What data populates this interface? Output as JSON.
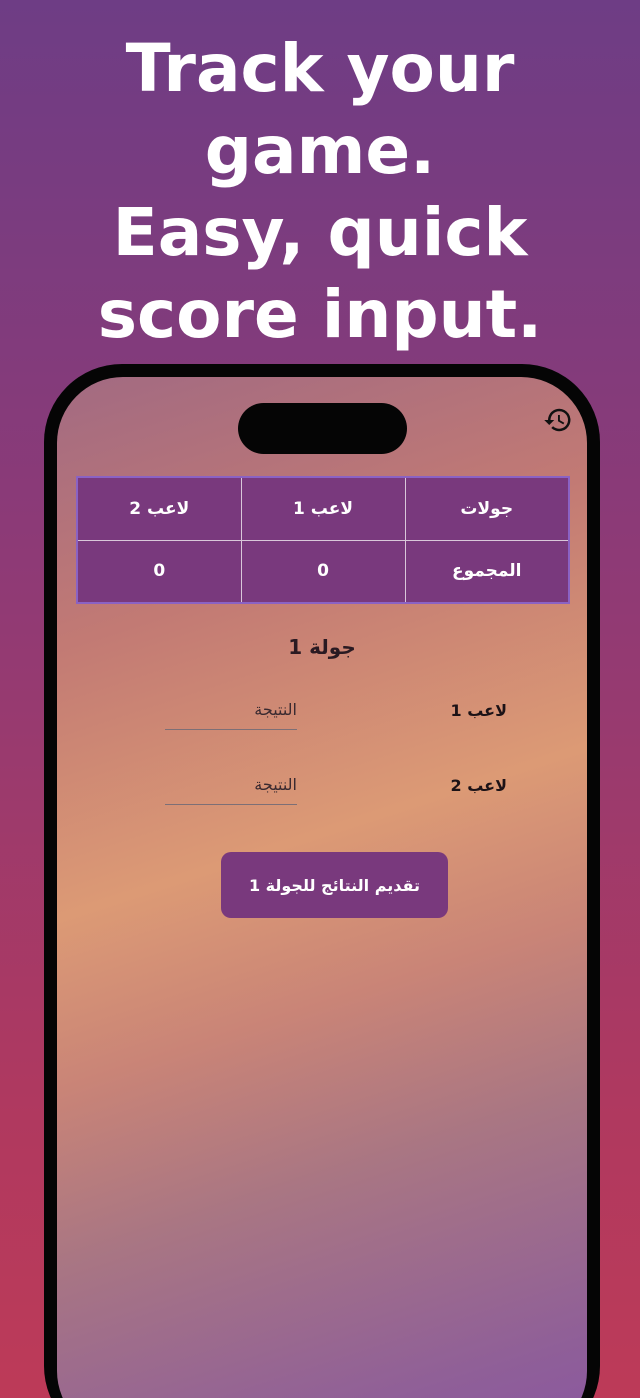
{
  "headline": {
    "line1": "Track your",
    "line2": "game.",
    "line3": "Easy, quick",
    "line4": "score input."
  },
  "history_icon": "history-icon",
  "table": {
    "header": [
      "جولات",
      "لاعب 1",
      "لاعب 2"
    ],
    "total_row": [
      "المجموع",
      "0",
      "0"
    ]
  },
  "round": {
    "title": "جولة 1"
  },
  "players": [
    {
      "label": "لاعب 1",
      "score_placeholder": "النتيجة",
      "score_value": ""
    },
    {
      "label": "لاعب 2",
      "score_placeholder": "النتيجة",
      "score_value": ""
    }
  ],
  "submit_label": "تقديم النتائج للجولة 1",
  "colors": {
    "accent": "#79397d",
    "table_border": "#8a62c4"
  }
}
